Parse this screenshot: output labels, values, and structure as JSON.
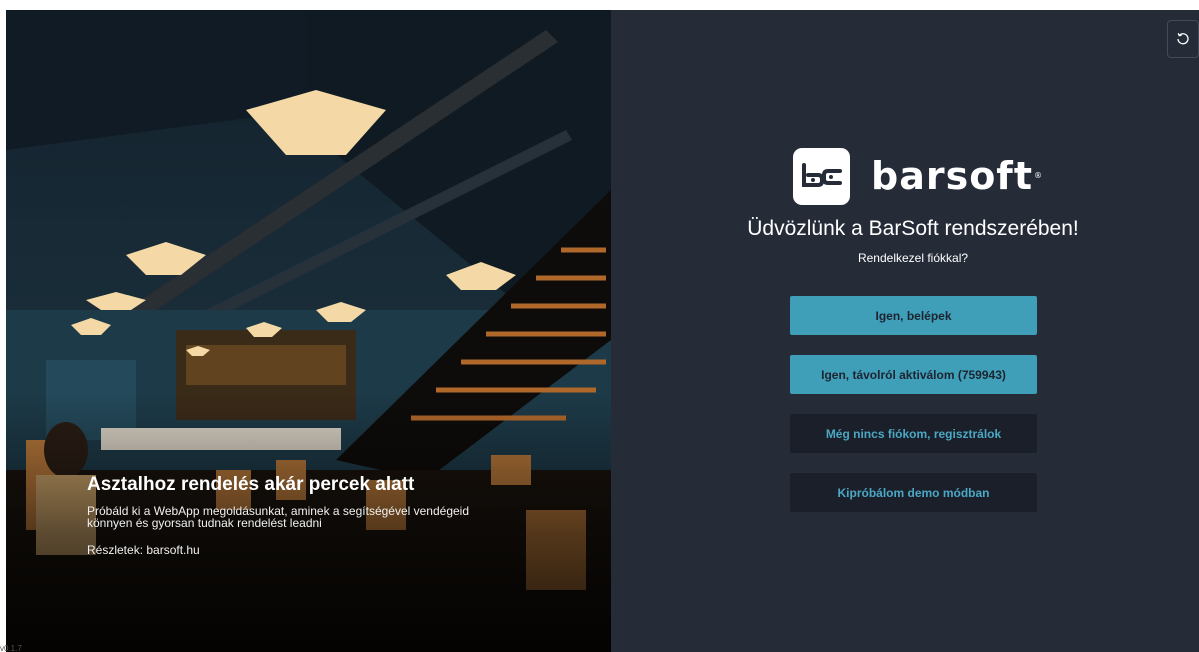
{
  "hero": {
    "promo_title": "Asztalhoz rendelés akár percek alatt",
    "promo_text_line1": "Próbáld ki a WebApp megoldásunkat, aminek a segítségével vendégeid",
    "promo_text_line2": "könnyen és gyorsan tudnak rendelést leadni",
    "details_link": "Részletek: barsoft.hu",
    "version": "v0.1.7"
  },
  "panel": {
    "refresh_icon": "refresh-icon",
    "logo_wordmark": "barsoft",
    "logo_reg": "®",
    "welcome": "Üdvözlünk a BarSoft rendszerében!",
    "question": "Rendelkezel fiókkal?",
    "buttons": {
      "login": "Igen, belépek",
      "remote_activate": "Igen, távolról aktiválom (759943)",
      "register": "Még nincs fiókom, regisztrálok",
      "demo": "Kipróbálom demo módban"
    }
  },
  "colors": {
    "panel_bg": "#262b38",
    "primary_button": "#3f9fb9",
    "dark_button": "#1b1f29",
    "accent_text": "#4aa8c4"
  }
}
